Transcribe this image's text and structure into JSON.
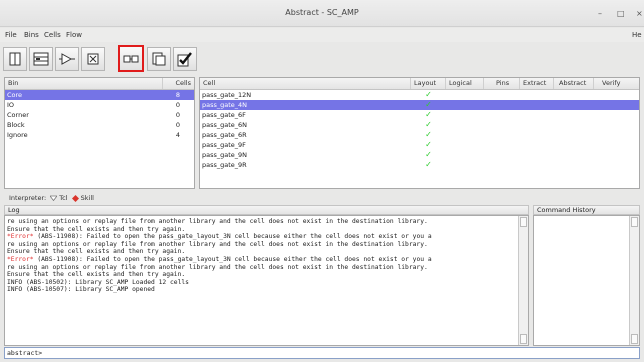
{
  "window": {
    "title": "Abstract - SC_AMP",
    "minimize_glyph": "–",
    "maximize_glyph": "□",
    "close_glyph": "×"
  },
  "menu": {
    "items": [
      "File",
      "Bins",
      "Cells",
      "Flow"
    ],
    "help": "He"
  },
  "toolbar": {
    "buttons": [
      {
        "icon": "library-icon",
        "selected": false
      },
      {
        "icon": "grid-layout-icon",
        "selected": false
      },
      {
        "icon": "buffer-icon",
        "selected": false
      },
      {
        "icon": "cell-icon",
        "selected": false
      },
      {
        "icon": "link-icon",
        "selected": true
      },
      {
        "icon": "layers-icon",
        "selected": false
      },
      {
        "icon": "check-icon",
        "selected": false
      }
    ],
    "selected_outline_color": "#e01b1b"
  },
  "bins": {
    "headers": {
      "bin": "Bin",
      "cells": "Cells"
    },
    "rows": [
      {
        "name": "Core",
        "count": "8",
        "selected": true
      },
      {
        "name": "IO",
        "count": "0",
        "selected": false
      },
      {
        "name": "Corner",
        "count": "0",
        "selected": false
      },
      {
        "name": "Block",
        "count": "0",
        "selected": false
      },
      {
        "name": "Ignore",
        "count": "4",
        "selected": false
      }
    ]
  },
  "cells": {
    "headers": [
      "Cell",
      "Layout",
      "Logical",
      "Pins",
      "Extract",
      "Abstract",
      "Verify"
    ],
    "rows": [
      {
        "name": "pass_gate_12N",
        "layout_ok": true,
        "selected": false
      },
      {
        "name": "pass_gate_4N",
        "layout_ok": true,
        "selected": true
      },
      {
        "name": "pass_gate_6F",
        "layout_ok": true,
        "selected": false
      },
      {
        "name": "pass_gate_6N",
        "layout_ok": true,
        "selected": false
      },
      {
        "name": "pass_gate_6R",
        "layout_ok": true,
        "selected": false
      },
      {
        "name": "pass_gate_9F",
        "layout_ok": true,
        "selected": false
      },
      {
        "name": "pass_gate_9N",
        "layout_ok": true,
        "selected": false
      },
      {
        "name": "pass_gate_9R",
        "layout_ok": true,
        "selected": false
      }
    ],
    "check_glyph": "✓",
    "selection_color": "#7574e6"
  },
  "interpreter": {
    "label": "Interpreter:",
    "option_tcl": "Tcl",
    "option_skill": "Skill",
    "selected": "Skill"
  },
  "log": {
    "title": "Log",
    "lines": [
      {
        "prefix": "",
        "text": "re using an options or replay file from another library and the cell does not exist in the destination library."
      },
      {
        "prefix": "",
        "text": "Ensure that the cell exists and then try again."
      },
      {
        "prefix": "",
        "text": ""
      },
      {
        "prefix": "*Error*",
        "text": " (ABS-11908): Failed to open the pass_gate_layout_3N cell because either the cell does not exist or you a"
      },
      {
        "prefix": "",
        "text": "re using an options or replay file from another library and the cell does not exist in the destination library."
      },
      {
        "prefix": "",
        "text": "Ensure that the cell exists and then try again."
      },
      {
        "prefix": "",
        "text": ""
      },
      {
        "prefix": "*Error*",
        "text": " (ABS-11908): Failed to open the pass_gate_layout_3N cell because either the cell does not exist or you a"
      },
      {
        "prefix": "",
        "text": "re using an options or replay file from another library and the cell does not exist in the destination library."
      },
      {
        "prefix": "",
        "text": "Ensure that the cell exists and then try again."
      },
      {
        "prefix": "",
        "text": ""
      },
      {
        "prefix": "",
        "text": "INFO (ABS-10502): Library SC_AMP Loaded 12 cells"
      },
      {
        "prefix": "",
        "text": "INFO (ABS-10507): Library SC_AMP opened"
      }
    ],
    "error_color": "#e03030"
  },
  "command_history": {
    "title": "Command History"
  },
  "command_line": {
    "value": "abstract>"
  }
}
